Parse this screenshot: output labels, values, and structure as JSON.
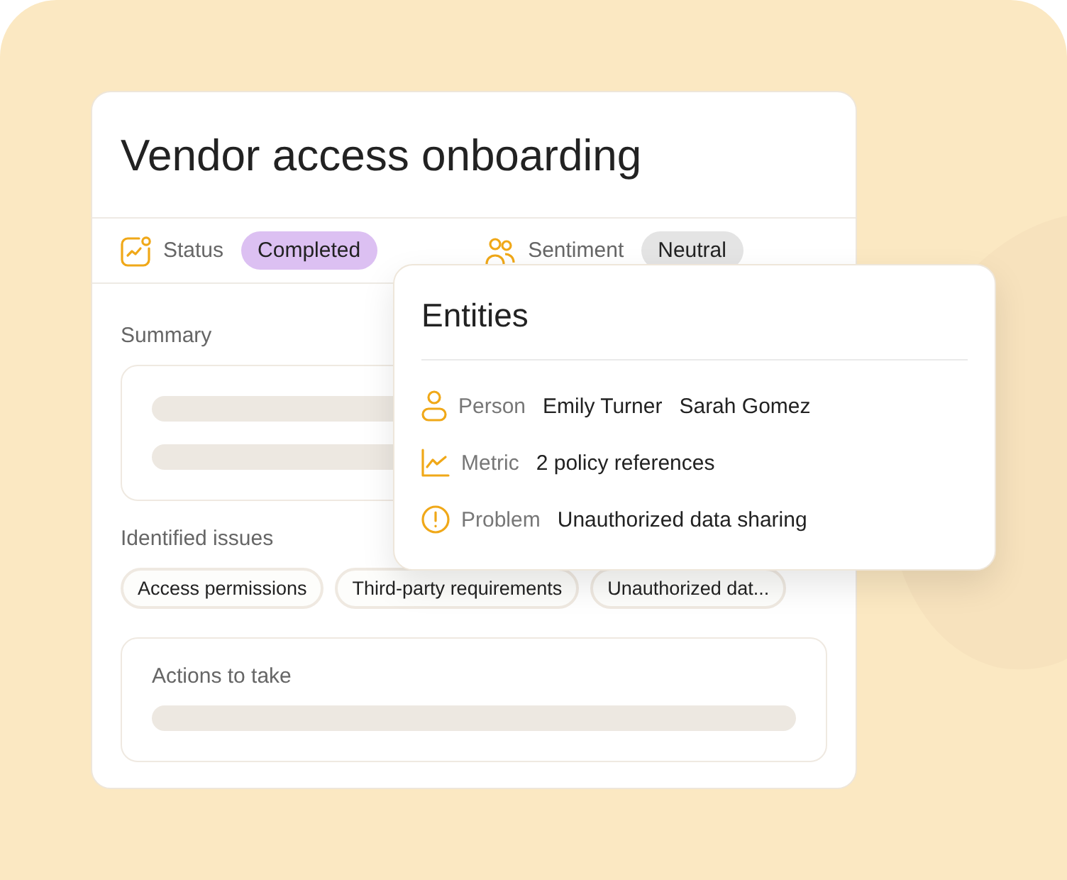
{
  "card": {
    "title": "Vendor access onboarding",
    "status": {
      "label": "Status",
      "value": "Completed"
    },
    "sentiment": {
      "label": "Sentiment",
      "value": "Neutral"
    },
    "summary": {
      "label": "Summary"
    },
    "issues": {
      "label": "Identified issues",
      "chips": [
        "Access permissions",
        "Third-party requirements",
        "Unauthorized dat..."
      ]
    },
    "actions": {
      "label": "Actions to take"
    }
  },
  "entities": {
    "title": "Entities",
    "rows": [
      {
        "kind": "person",
        "label": "Person",
        "values": [
          "Emily Turner",
          "Sarah Gomez"
        ]
      },
      {
        "kind": "metric",
        "label": "Metric",
        "values": [
          "2 policy references"
        ]
      },
      {
        "kind": "problem",
        "label": "Problem",
        "values": [
          "Unauthorized data sharing"
        ]
      }
    ]
  }
}
